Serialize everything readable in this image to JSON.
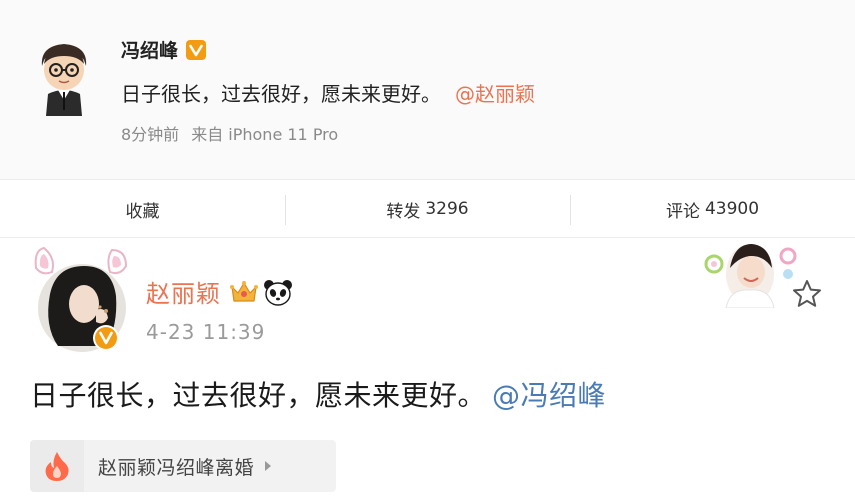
{
  "post1": {
    "author": "冯绍峰",
    "text": "日子很长，过去很好，愿未来更好。",
    "mention": "@赵丽颖",
    "time": "8分钟前",
    "source": "来自 iPhone 11 Pro",
    "verified_icon": "verified-v-badge-icon"
  },
  "actions": {
    "favorite_label": "收藏",
    "repost_label": "转发",
    "repost_count": "3296",
    "comment_label": "评论",
    "comment_count": "43900"
  },
  "post2": {
    "author": "赵丽颖",
    "time": "4-23 11:39",
    "text": "日子很长，过去很好，愿未来更好。",
    "mention": "@冯绍峰",
    "badges": [
      "crown-icon",
      "panda-icon"
    ]
  },
  "topic": {
    "label": "赵丽颖冯绍峰离婚",
    "icon": "fire-icon"
  },
  "colors": {
    "accent_orange": "#eb7350",
    "mention_blue": "#4a7bb5",
    "verified_orange": "#f39c12"
  }
}
